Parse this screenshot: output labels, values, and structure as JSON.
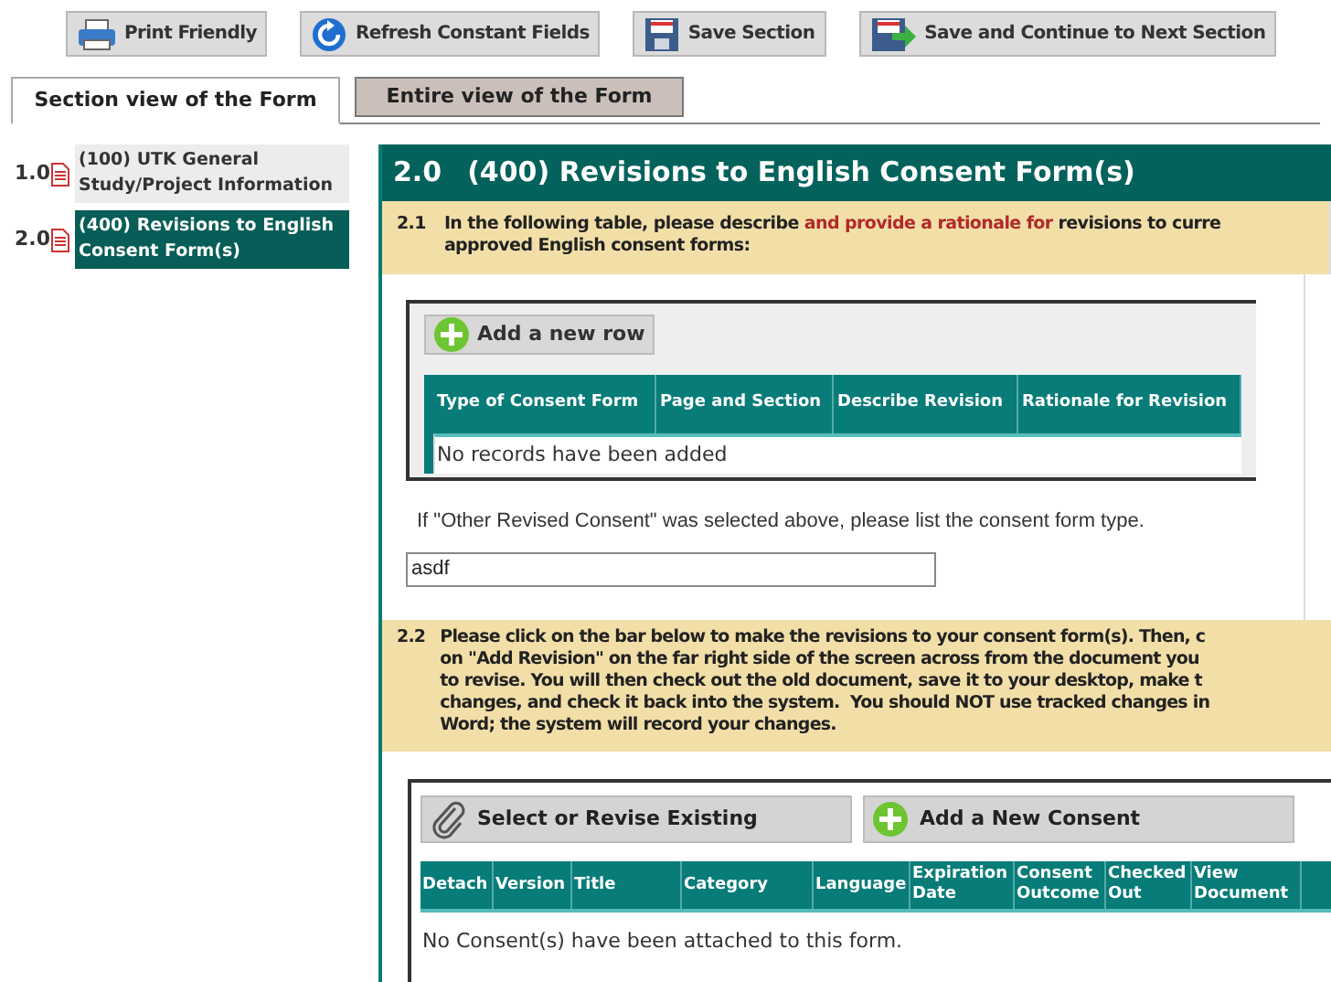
{
  "toolbar": [
    {
      "kind": "print",
      "label": "Print Friendly"
    },
    {
      "kind": "refresh",
      "label": "Refresh Constant Fields"
    },
    {
      "kind": "save",
      "label": "Save Section"
    },
    {
      "kind": "save-next",
      "label": "Save and Continue to Next Section"
    }
  ],
  "tabs": [
    {
      "label": "Section view of the Form",
      "selected": true
    },
    {
      "label": "Entire view of the Form",
      "selected": false
    }
  ],
  "sidebar": {
    "items": [
      {
        "number": "1.0",
        "label": "(100) UTK General Study/Project Information",
        "selected": false
      },
      {
        "number": "2.0",
        "label": "(400) Revisions to English Consent Form(s)",
        "selected": true
      }
    ]
  },
  "section": {
    "number": "2.0",
    "title": "(400) Revisions to English Consent Form(s)"
  },
  "question_1": {
    "number": "2.1",
    "text_before": "In the following table, please describe ",
    "text_highlight": "and provide a rationale for",
    "text_after": " revisions to curre",
    "text_line_2": "approved English consent forms:",
    "add_row_button": "Add a new row",
    "table": {
      "columns": [
        "Type of Consent Form",
        "Page and Section",
        "Describe Revision",
        "Rationale for Revision"
      ],
      "empty_message": "No records have been added"
    },
    "other_label": "If \"Other Revised Consent\" was selected above, please list the consent form type.",
    "other_value": "asdf"
  },
  "question_2": {
    "number": "2.2",
    "lines": [
      "Please click on the bar below to make the revisions to your consent form(s). Then, c",
      "on \"Add Revision\" on the far right side of the screen across from the document you",
      "to revise. You will then check out the old document, save it to your desktop, make t",
      "changes, and check it back into the system.  You should NOT use tracked changes in",
      "Word; the system will record your changes."
    ],
    "buttons": [
      {
        "kind": "attach",
        "label": "Select or Revise Existing"
      },
      {
        "kind": "add",
        "label": "Add a New Consent"
      }
    ],
    "table": {
      "columns": [
        "Detach",
        "Version",
        "Title",
        "Category",
        "Language",
        "Expiration Date",
        "Consent Outcome",
        "Checked Out",
        "View Document"
      ],
      "empty_message": "No Consent(s) have been attached to this form."
    }
  }
}
